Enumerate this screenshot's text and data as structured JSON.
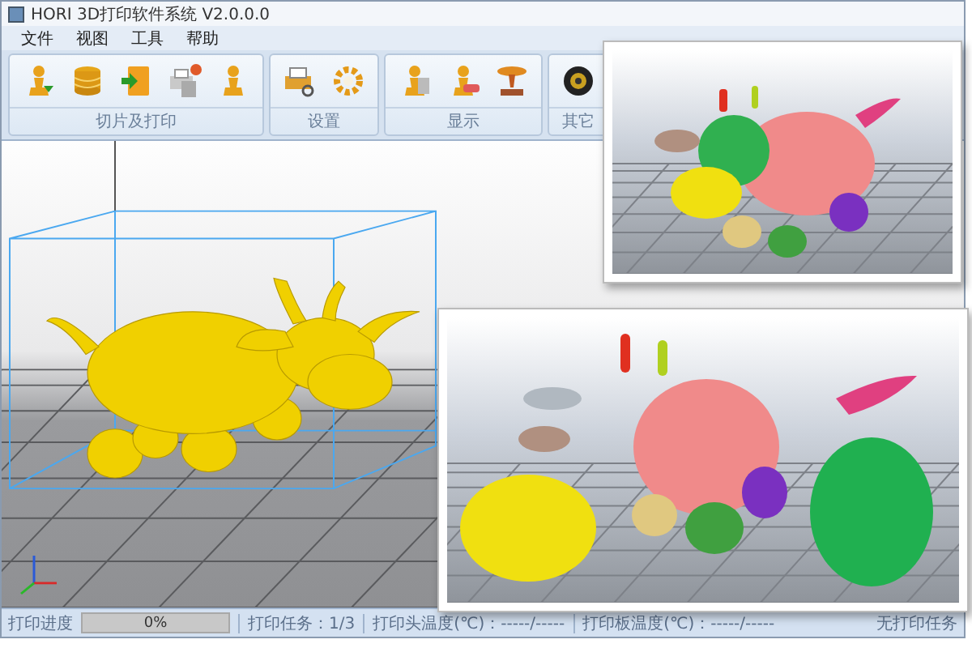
{
  "window": {
    "title": "HORI 3D打印软件系统 V2.0.0.0"
  },
  "menu": [
    {
      "label": "文件"
    },
    {
      "label": "视图"
    },
    {
      "label": "工具"
    },
    {
      "label": "帮助"
    }
  ],
  "ribbon": [
    {
      "label": "切片及打印",
      "buttons": [
        {
          "kind": "pawn-down"
        },
        {
          "kind": "stack"
        },
        {
          "kind": "export"
        },
        {
          "kind": "printer-files"
        },
        {
          "kind": "pawn"
        }
      ]
    },
    {
      "label": "设置",
      "buttons": [
        {
          "kind": "printer"
        },
        {
          "kind": "gear"
        }
      ]
    },
    {
      "label": "显示",
      "buttons": [
        {
          "kind": "pawn-page"
        },
        {
          "kind": "pawn-ruler"
        },
        {
          "kind": "platform"
        }
      ]
    },
    {
      "label": "其它",
      "buttons": [
        {
          "kind": "lens"
        }
      ]
    }
  ],
  "status_bar": {
    "progress_label": "打印进度",
    "progress": {
      "level": 0,
      "reading": "0%"
    },
    "task": "打印任务：1/3",
    "head_temp": "打印头温度(℃)：-----/-----",
    "bed_temp": "打印板温度(℃)：-----/-----",
    "message": "无打印任务"
  }
}
